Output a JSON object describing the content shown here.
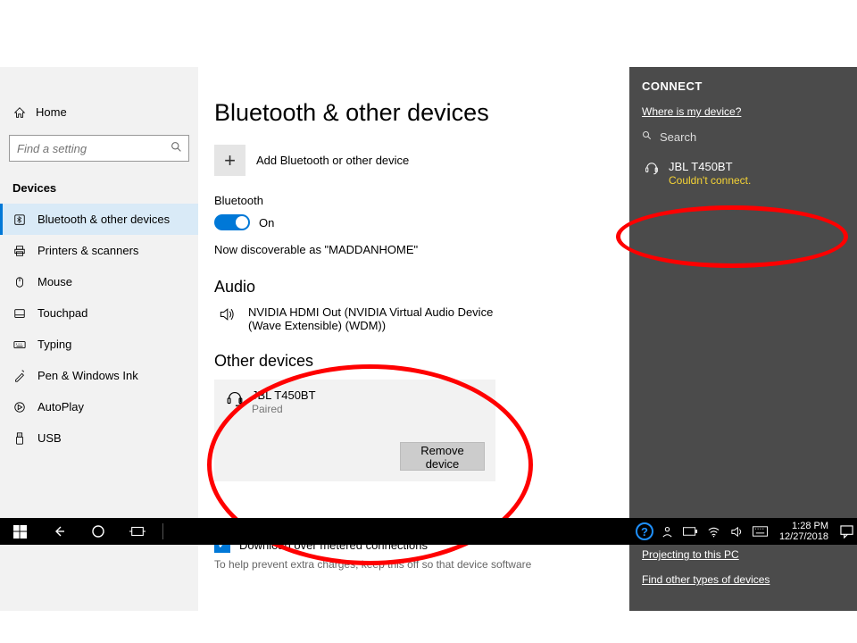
{
  "sidebar": {
    "home": "Home",
    "search_placeholder": "Find a setting",
    "section": "Devices",
    "items": [
      {
        "icon": "bt",
        "label": "Bluetooth & other devices",
        "active": true
      },
      {
        "icon": "printer",
        "label": "Printers & scanners"
      },
      {
        "icon": "mouse",
        "label": "Mouse"
      },
      {
        "icon": "touchpad",
        "label": "Touchpad"
      },
      {
        "icon": "typing",
        "label": "Typing"
      },
      {
        "icon": "pen",
        "label": "Pen & Windows Ink"
      },
      {
        "icon": "autoplay",
        "label": "AutoPlay"
      },
      {
        "icon": "usb",
        "label": "USB"
      }
    ]
  },
  "main": {
    "title": "Bluetooth & other devices",
    "add_label": "Add Bluetooth or other device",
    "bt_label": "Bluetooth",
    "bt_state": "On",
    "discoverable": "Now discoverable as \"MADDANHOME\"",
    "audio_head": "Audio",
    "audio_device": "NVIDIA HDMI Out (NVIDIA Virtual Audio Device (Wave Extensible) (WDM))",
    "other_head": "Other devices",
    "other_device": {
      "name": "JBL T450BT",
      "status": "Paired"
    },
    "remove_label": "Remove device",
    "metered_label": "Download over metered connections",
    "metered_help": "To help prevent extra charges, keep this off so that device software"
  },
  "connect": {
    "title": "CONNECT",
    "where": "Where is my device?",
    "search": "Search",
    "device": {
      "name": "JBL T450BT",
      "status": "Couldn't connect."
    },
    "projecting": "Projecting to this PC",
    "find_other": "Find other types of devices"
  },
  "taskbar": {
    "time": "1:28 PM",
    "date": "12/27/2018"
  }
}
